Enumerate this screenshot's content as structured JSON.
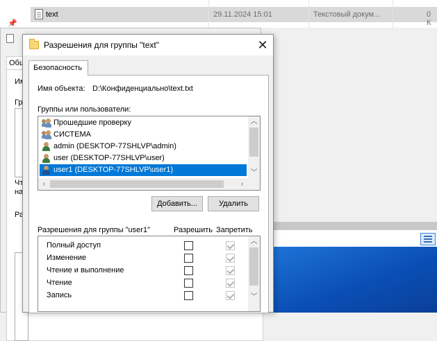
{
  "explorer": {
    "file_name": "text",
    "file_date": "29.11.2024 15:01",
    "file_type": "Текстовый докум...",
    "file_size": "0 К"
  },
  "back_window": {
    "tab_label": "Общ",
    "label_1": "Им",
    "label_2": "Гр",
    "label_3": "Чт",
    "label_4": "на",
    "label_5": "Ра"
  },
  "dialog": {
    "title": "Разрешения для группы \"text\"",
    "close_glyph": "✕",
    "tab": "Безопасность",
    "object_label": "Имя объекта:",
    "object_value": "D:\\Конфиденциально\\text.txt",
    "groups_label": "Группы или пользователи:",
    "users": [
      {
        "name": "Прошедшие проверку",
        "icon": "group-icon"
      },
      {
        "name": "СИСТЕМА",
        "icon": "group-icon"
      },
      {
        "name": "admin (DESKTOP-77SHLVP\\admin)",
        "icon": "user-icon"
      },
      {
        "name": "user (DESKTOP-77SHLVP\\user)",
        "icon": "user-icon"
      },
      {
        "name": "user1 (DESKTOP-77SHLVP\\user1)",
        "icon": "user-icon",
        "selected": true
      }
    ],
    "add_button": "Добавить...",
    "remove_button": "Удалить",
    "perm_header": "Разрешения для группы \"user1\"",
    "allow_header": "Разрешить",
    "deny_header": "Запретить",
    "permissions": [
      {
        "name": "Полный доступ",
        "allow": false,
        "deny": true
      },
      {
        "name": "Изменение",
        "allow": false,
        "deny": true
      },
      {
        "name": "Чтение и выполнение",
        "allow": false,
        "deny": true
      },
      {
        "name": "Чтение",
        "allow": false,
        "deny": true
      },
      {
        "name": "Запись",
        "allow": false,
        "deny": true
      }
    ]
  }
}
